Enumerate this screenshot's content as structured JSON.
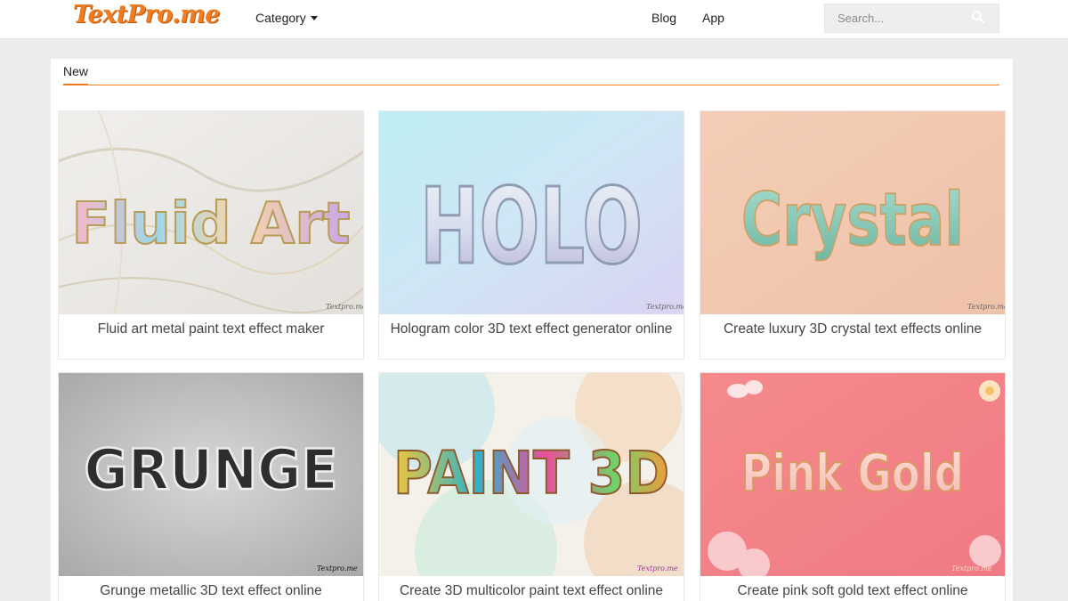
{
  "navbar": {
    "logo": "TextPro.me",
    "category_label": "Category",
    "blog_label": "Blog",
    "app_label": "App",
    "search_placeholder": "Search..."
  },
  "section": {
    "title": "New"
  },
  "watermark": "Textpro.me",
  "cards": [
    {
      "art_text": "Fluid Art",
      "title": "Fluid art metal paint text effect maker"
    },
    {
      "art_text": "HOLO",
      "title": "Hologram color 3D text effect generator online"
    },
    {
      "art_text": "Crystal",
      "title": "Create luxury 3D crystal text effects online"
    },
    {
      "art_text": "GRUNGE",
      "title": "Grunge metallic 3D text effect online"
    },
    {
      "art_text": "PAINT 3D",
      "title": "Create 3D multicolor paint text effect online"
    },
    {
      "art_text": "Pink Gold",
      "title": "Create pink soft gold text effect online"
    }
  ],
  "colors": {
    "accent": "#f07d21"
  }
}
